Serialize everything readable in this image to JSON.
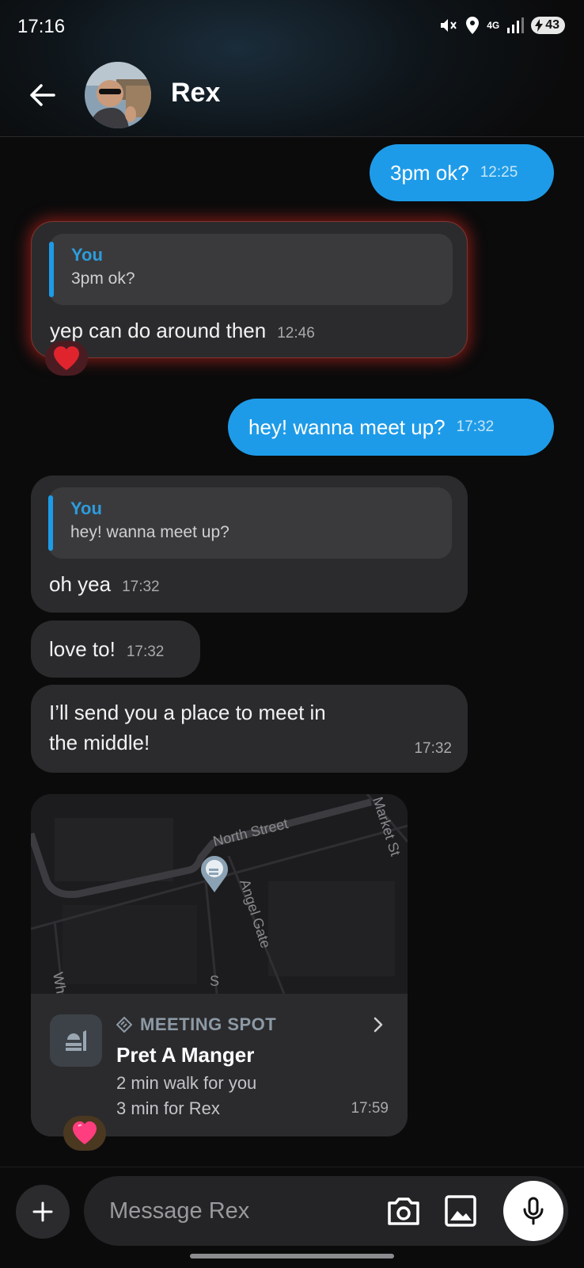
{
  "status_bar": {
    "time": "17:16",
    "network": "4G",
    "battery": "43"
  },
  "header": {
    "contact_name": "Rex"
  },
  "messages": [
    {
      "from": "me",
      "text": "3pm ok?",
      "time": "12:25"
    },
    {
      "from": "them",
      "quote_author": "You",
      "quote_text": "3pm ok?",
      "text": "yep can do around then",
      "time": "12:46",
      "reaction": "heart-icon"
    },
    {
      "from": "me",
      "text": "hey! wanna meet up?",
      "time": "17:32"
    },
    {
      "from": "them",
      "quote_author": "You",
      "quote_text": "hey! wanna meet up?",
      "text": "oh yea",
      "time": "17:32"
    },
    {
      "from": "them",
      "text": "love to!",
      "time": "17:32"
    },
    {
      "from": "them",
      "text_line1": "I’ll send you a place to meet in",
      "text_line2": "the middle!",
      "time": "17:32"
    }
  ],
  "meeting_card": {
    "map_labels": {
      "north_street": "North Street",
      "angel_gate": "Angel Gate",
      "market_st": "Market St",
      "wh": "Wh",
      "s": "S"
    },
    "kicker": "MEETING SPOT",
    "place": "Pret A Manger",
    "line1": "2 min walk for you",
    "line2": "3 min for Rex",
    "time": "17:59",
    "reaction": "sparkling-heart-icon"
  },
  "composer": {
    "placeholder": "Message Rex"
  },
  "colors": {
    "outgoing_bubble": "#1e9be8",
    "incoming_bubble": "#2b2b2d",
    "quote_author": "#2d9cdb",
    "background": "#0b0b0c"
  }
}
